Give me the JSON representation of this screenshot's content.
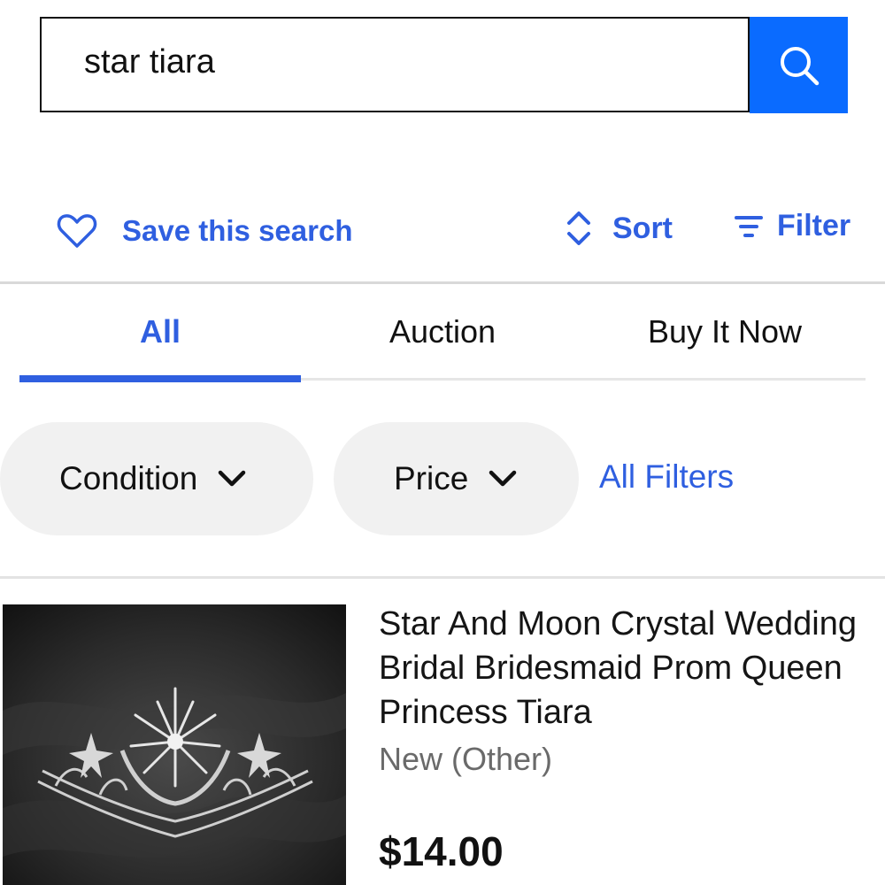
{
  "search": {
    "query": "star tiara",
    "button_icon": "search-icon"
  },
  "actions": {
    "save_search_label": "Save this search",
    "save_search_icon": "heart-outline-icon",
    "sort_label": "Sort",
    "sort_icon": "up-down-chevron-icon",
    "filter_label": "Filter",
    "filter_icon": "filter-lines-icon"
  },
  "tabs": [
    {
      "label": "All",
      "active": true
    },
    {
      "label": "Auction",
      "active": false
    },
    {
      "label": "Buy It Now",
      "active": false
    }
  ],
  "chips": [
    {
      "label": "Condition",
      "icon": "chevron-down-icon"
    },
    {
      "label": "Price",
      "icon": "chevron-down-icon"
    }
  ],
  "all_filters_label": "All Filters",
  "listing": {
    "title": "Star And Moon Crystal Wedding Bridal Bridesmaid Prom Queen Princess Tiara",
    "condition": "New (Other)",
    "price": "$14.00",
    "image_icon": "tiara-product-image"
  },
  "colors": {
    "accent": "#2f5fe0",
    "search_button": "#0a6bff",
    "chip_bg": "#f1f1f1"
  }
}
